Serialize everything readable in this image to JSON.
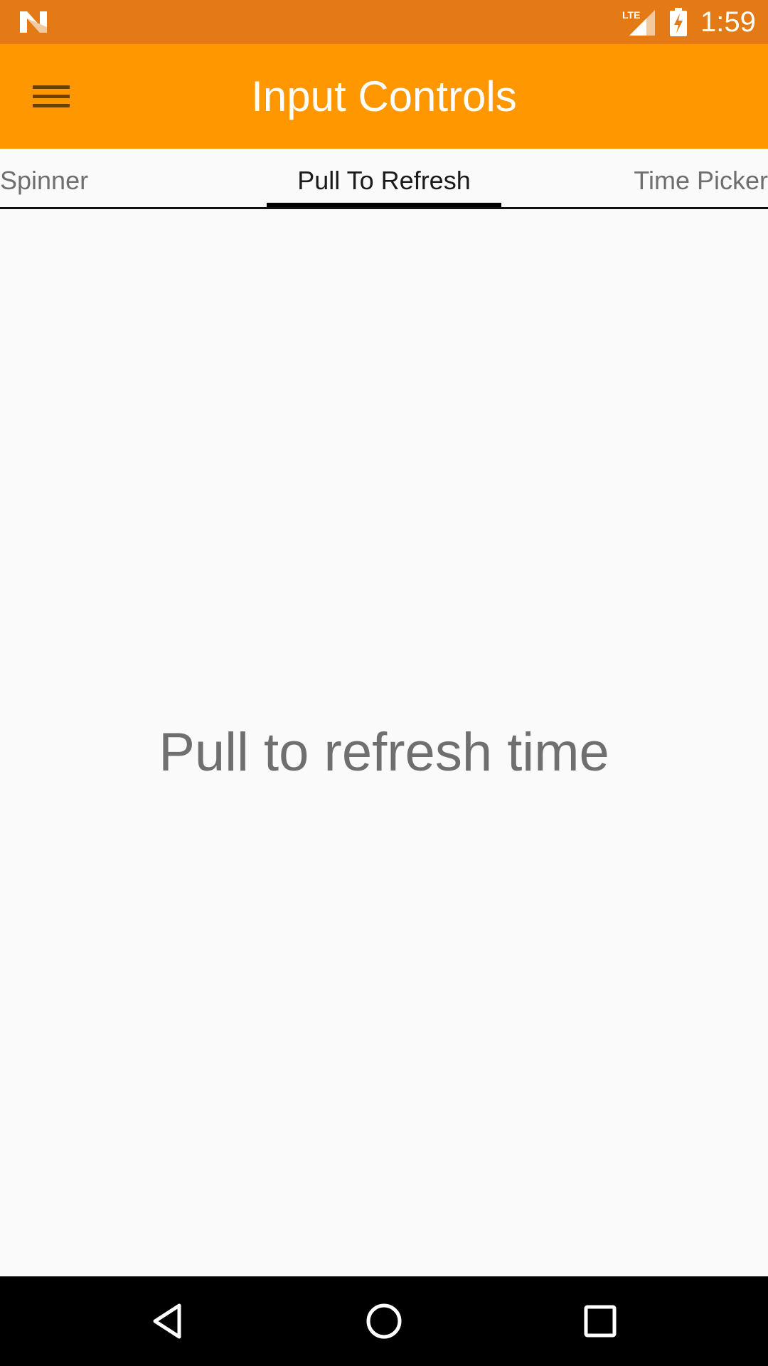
{
  "status_bar": {
    "time": "1:59",
    "network": "LTE",
    "icons": [
      "n-logo-icon",
      "lte-signal-icon",
      "battery-charging-icon"
    ]
  },
  "toolbar": {
    "title": "Input Controls",
    "menu_icon": "hamburger-menu-icon"
  },
  "tabs": {
    "items": [
      {
        "label": "Spinner",
        "selected": false
      },
      {
        "label": "Pull To Refresh",
        "selected": true
      },
      {
        "label": "Time Picker",
        "selected": false
      }
    ]
  },
  "content": {
    "message": "Pull to refresh time"
  },
  "nav_bar": {
    "buttons": [
      "back-icon",
      "home-icon",
      "recents-icon"
    ]
  },
  "colors": {
    "status_bar": "#e47a15",
    "toolbar": "#ff9800",
    "background": "#fafafa",
    "tab_selected_text": "#1a1a1a",
    "tab_text": "#6f6f6f",
    "indicator": "#000000",
    "nav_bar": "#000000"
  }
}
